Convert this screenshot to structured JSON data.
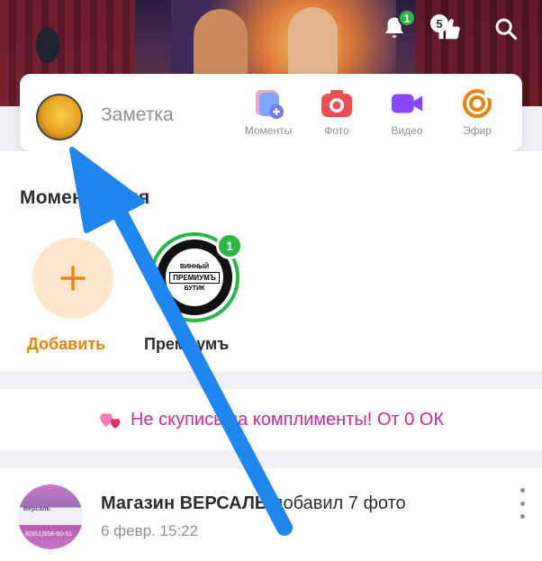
{
  "header": {
    "notifications_count": "1",
    "likes_count": "5"
  },
  "composer": {
    "note_label": "Заметка",
    "actions": [
      {
        "label": "Моменты",
        "icon": "moments-icon",
        "color": "#6f7bf7"
      },
      {
        "label": "Фото",
        "icon": "camera-icon",
        "color": "#ee4d54"
      },
      {
        "label": "Видео",
        "icon": "video-camera-icon",
        "color": "#8b46ff"
      },
      {
        "label": "Эфир",
        "icon": "live-broadcast-icon",
        "color": "#ee8208"
      }
    ]
  },
  "moments": {
    "title": "Моменты дня",
    "add_label": "Добавить",
    "story_label": "Премиумъ",
    "story_badge": "1",
    "story_logo": {
      "top": "ВИННЫЙ",
      "middle": "ПРЕМИУМЪ",
      "bottom": "БУТИК"
    }
  },
  "promo": {
    "text": "Не скупись на комплименты! От 0 ОК"
  },
  "post": {
    "author": "Магазин ВЕРСАЛЬ",
    "action": " добавил 7 фото",
    "time": "6 февр. 15:22",
    "avatar_text_top": "Версаль",
    "avatar_text_bottom": "8(851)558-60-51"
  },
  "colors": {
    "accent_orange": "#ee8208",
    "badge_green": "#28b84a",
    "promo_pink": "#d0289a",
    "arrow_blue": "#1f86f0"
  }
}
